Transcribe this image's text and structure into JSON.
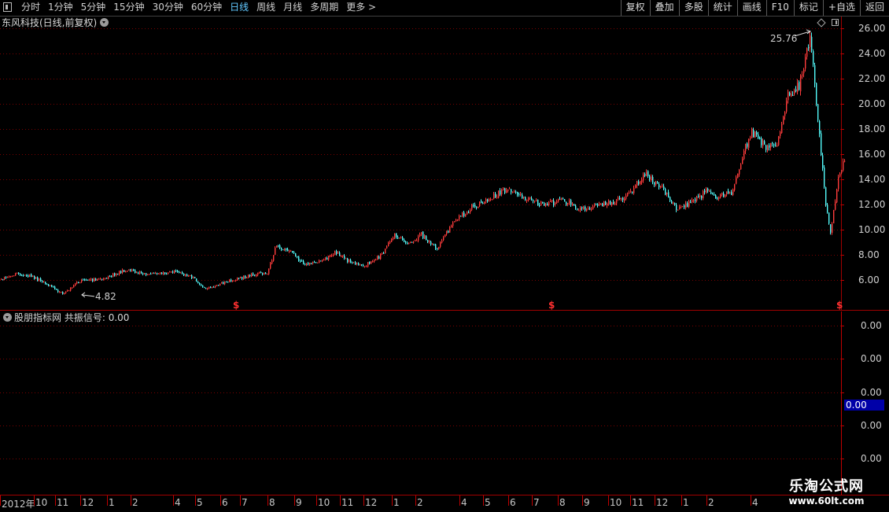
{
  "toolbar": {
    "periods": [
      "分时",
      "1分钟",
      "5分钟",
      "15分钟",
      "30分钟",
      "60分钟",
      "日线",
      "周线",
      "月线",
      "多周期",
      "更多 >"
    ],
    "active_period": "日线",
    "tools": [
      "复权",
      "叠加",
      "多股",
      "统计",
      "画线",
      "F10",
      "标记",
      "+自选",
      "返回"
    ]
  },
  "main_chart": {
    "title": "东风科技(日线,前复权)",
    "y_labels": [
      "26.00",
      "24.00",
      "22.00",
      "20.00",
      "18.00",
      "16.00",
      "14.00",
      "12.00",
      "10.00",
      "8.00",
      "6.00"
    ],
    "high_marker": "25.76",
    "low_marker": "4.82",
    "signal_marker": "$"
  },
  "indicator": {
    "title": "股朋指标网",
    "signal_name": "共振信号",
    "signal_value": "0.00",
    "y_labels": [
      "0.00",
      "0.00",
      "0.00",
      "0.00",
      "0.00"
    ],
    "current_value": "0.00"
  },
  "date_axis": {
    "labels": [
      "2012年",
      "10",
      "11",
      "12",
      "1",
      "2",
      "4",
      "5",
      "6",
      "7",
      "8",
      "9",
      "10",
      "11",
      "12",
      "1",
      "2",
      "4",
      "5",
      "6",
      "7",
      "8",
      "9",
      "10",
      "11",
      "12",
      "1",
      "2",
      "4"
    ]
  },
  "watermark": {
    "title": "乐淘公式网",
    "url": "www.60lt.com"
  },
  "chart_data": {
    "type": "candlestick",
    "series": [
      {
        "index": 0,
        "close": 6.0
      },
      {
        "index": 20,
        "close": 6.5
      },
      {
        "index": 40,
        "close": 6.3
      },
      {
        "index": 60,
        "close": 5.6
      },
      {
        "index": 80,
        "close": 4.9
      },
      {
        "index": 100,
        "close": 5.9
      },
      {
        "index": 130,
        "close": 6.1
      },
      {
        "index": 160,
        "close": 6.8
      },
      {
        "index": 190,
        "close": 6.4
      },
      {
        "index": 220,
        "close": 6.7
      },
      {
        "index": 245,
        "close": 6.2
      },
      {
        "index": 260,
        "close": 5.3
      },
      {
        "index": 290,
        "close": 5.9
      },
      {
        "index": 320,
        "close": 6.4
      },
      {
        "index": 340,
        "close": 6.6
      },
      {
        "index": 350,
        "close": 8.7
      },
      {
        "index": 370,
        "close": 8.2
      },
      {
        "index": 385,
        "close": 7.3
      },
      {
        "index": 410,
        "close": 7.5
      },
      {
        "index": 425,
        "close": 8.2
      },
      {
        "index": 445,
        "close": 7.4
      },
      {
        "index": 465,
        "close": 7.2
      },
      {
        "index": 485,
        "close": 8.0
      },
      {
        "index": 500,
        "close": 9.6
      },
      {
        "index": 520,
        "close": 8.8
      },
      {
        "index": 535,
        "close": 9.6
      },
      {
        "index": 555,
        "close": 8.5
      },
      {
        "index": 575,
        "close": 10.5
      },
      {
        "index": 600,
        "close": 11.8
      },
      {
        "index": 620,
        "close": 12.5
      },
      {
        "index": 645,
        "close": 13.2
      },
      {
        "index": 665,
        "close": 12.5
      },
      {
        "index": 690,
        "close": 12.0
      },
      {
        "index": 715,
        "close": 12.3
      },
      {
        "index": 740,
        "close": 11.6
      },
      {
        "index": 770,
        "close": 12.1
      },
      {
        "index": 795,
        "close": 12.6
      },
      {
        "index": 820,
        "close": 14.4
      },
      {
        "index": 840,
        "close": 13.4
      },
      {
        "index": 860,
        "close": 11.6
      },
      {
        "index": 880,
        "close": 12.2
      },
      {
        "index": 900,
        "close": 13.2
      },
      {
        "index": 910,
        "close": 12.6
      },
      {
        "index": 930,
        "close": 13.0
      },
      {
        "index": 945,
        "close": 16.2
      },
      {
        "index": 955,
        "close": 17.8
      },
      {
        "index": 975,
        "close": 16.4
      },
      {
        "index": 990,
        "close": 17.2
      },
      {
        "index": 1000,
        "close": 20.5
      },
      {
        "index": 1015,
        "close": 21.5
      },
      {
        "index": 1030,
        "close": 25.5
      },
      {
        "index": 1040,
        "close": 18.0
      },
      {
        "index": 1050,
        "close": 11.5
      },
      {
        "index": 1055,
        "close": 9.8
      },
      {
        "index": 1065,
        "close": 14.0
      },
      {
        "index": 1073,
        "close": 15.6
      }
    ],
    "ylim": [
      4.2,
      26.7
    ],
    "high": 25.76,
    "low": 4.82
  }
}
